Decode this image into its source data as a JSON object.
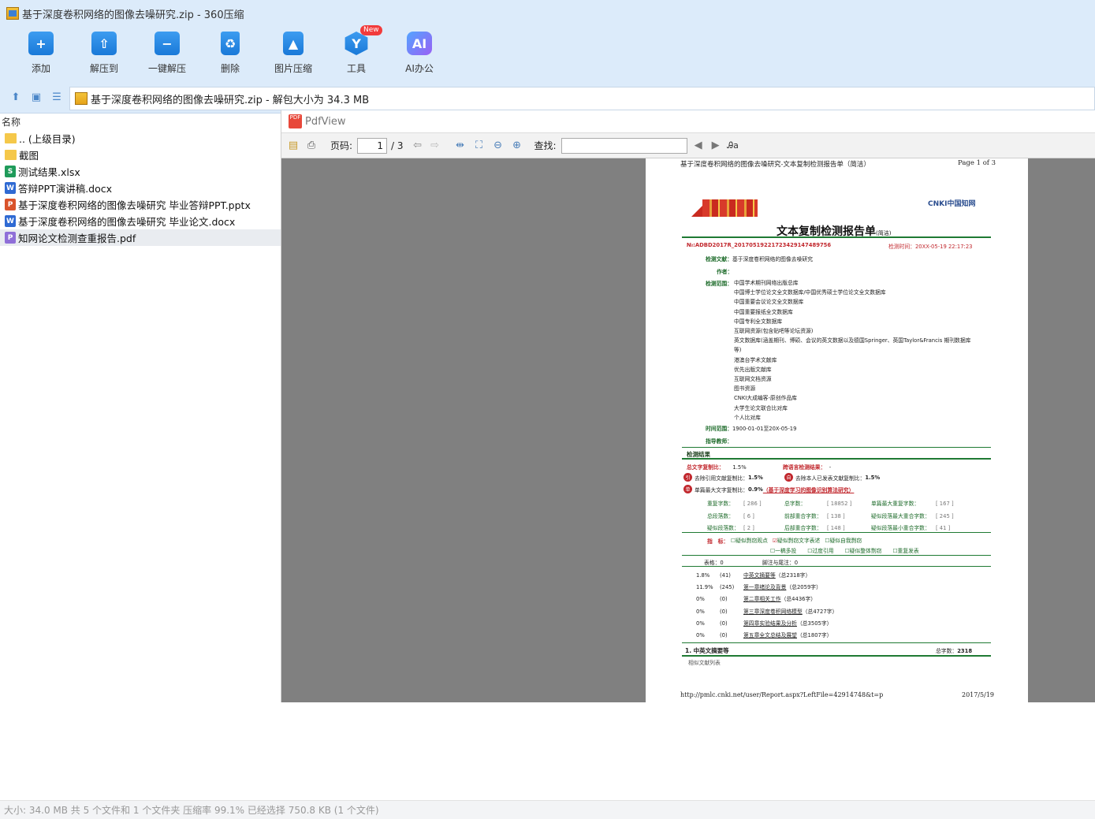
{
  "window": {
    "title": "基于深度卷积网络的图像去噪研究.zip - 360压缩"
  },
  "toolbar": {
    "buttons": [
      {
        "label": "添加",
        "icon": "add-icon"
      },
      {
        "label": "解压到",
        "icon": "extract-to-icon"
      },
      {
        "label": "一键解压",
        "icon": "one-click-extract-icon"
      },
      {
        "label": "删除",
        "icon": "trash-icon"
      },
      {
        "label": "图片压缩",
        "icon": "image-compress-icon"
      },
      {
        "label": "工具",
        "icon": "tools-icon",
        "badge": "New"
      },
      {
        "label": "AI办公",
        "icon": "ai-icon"
      }
    ]
  },
  "address": {
    "path": "基于深度卷积网络的图像去噪研究.zip - 解包大小为 34.3 MB"
  },
  "filelist": {
    "column": "名称",
    "items": [
      {
        "name": ".. (上级目录)",
        "type": "folder"
      },
      {
        "name": "截图",
        "type": "folder"
      },
      {
        "name": "测试结果.xlsx",
        "type": "xlsx"
      },
      {
        "name": "答辩PPT演讲稿.docx",
        "type": "docx"
      },
      {
        "name": "基于深度卷积网络的图像去噪研究 毕业答辩PPT.pptx",
        "type": "pptx"
      },
      {
        "name": "基于深度卷积网络的图像去噪研究 毕业论文.docx",
        "type": "docx"
      },
      {
        "name": "知网论文检测查重报告.pdf",
        "type": "pdf"
      }
    ]
  },
  "pdfview": {
    "title": "PdfView",
    "page_label": "页码:",
    "page_current": "1",
    "page_total": "/ 3",
    "find_label": "查找:",
    "header_left": "基于深度卷积网络的图像去噪研究-文本复制检测报告单（简洁）",
    "header_right": "Page 1 of 3",
    "cnki_logo": "CNKI中国知网",
    "report_title": "文本复制检测报告单",
    "report_title_sub": "(简洁)",
    "report_no": "№:ADBD2017R_20170519221723429147489756",
    "report_time": "检测时间：20XX-05-19 22:17:23",
    "doc_label": "检测文献：",
    "doc_value": "基于深度卷积网络的图像去噪研究",
    "author_label": "作者：",
    "range_label": "检测范围：",
    "ranges": [
      "中国学术期刊网络出版总库",
      "中国博士学位论文全文数据库/中国优秀硕士学位论文全文数据库",
      "中国重要会议论文全文数据库",
      "中国重要报纸全文数据库",
      "中国专利全文数据库",
      "互联网资源(包含贴吧等论坛资源)",
      "英文数据库(涵盖期刊、博硕、会议的英文数据以及德国Springer、英国Taylor&Francis 期刊数据库",
      "等)",
      "港澳台学术文献库",
      "优先出版文献库",
      "互联网文档资源",
      "图书资源",
      "CNKI大成编客-原创作品库",
      "大学生论文联合比对库",
      "个人比对库"
    ],
    "time_label": "时间范围：",
    "time_value": "1900-01-01至20X-05-19",
    "teacher_label": "指导教师：",
    "result_header": "检测结果",
    "total_label": "总文字复制比：",
    "total_value": "1.5%",
    "cross_label": "跨语言检测结果：",
    "cross_value": "-",
    "quote_label": "去除引用文献复制比：",
    "quote_value": "1.5%",
    "self_label": "去除本人已发表文献复制比：",
    "self_value": "1.5%",
    "single_label": "单篇最大文字复制比：",
    "single_value": "0.9%",
    "single_link": "（基于深度学习的图像识别算法研究）",
    "stats": [
      [
        {
          "k": "重复字数：",
          "v": "[ 286 ]"
        },
        {
          "k": "总字数：",
          "v": "[ 18852 ]"
        },
        {
          "k": "单篇最大重复字数：",
          "v": "[ 167 ]"
        }
      ],
      [
        {
          "k": "总段落数：",
          "v": "[ 6 ]"
        },
        {
          "k": "前部重合字数：",
          "v": "[ 138 ]"
        },
        {
          "k": "疑似段落最大重合字数：",
          "v": "[ 245 ]"
        }
      ],
      [
        {
          "k": "疑似段落数：",
          "v": "[ 2 ]"
        },
        {
          "k": "后部重合字数：",
          "v": "[ 148 ]"
        },
        {
          "k": "疑似段落最小重合字数：",
          "v": "[ 41 ]"
        }
      ]
    ],
    "index_label": "指　标：",
    "indices": [
      "疑似剽窃观点",
      "疑似剽窃文字表述",
      "疑似自我剽窃",
      "一稿多投",
      "过度引用",
      "疑似整体剽窃",
      "重复发表"
    ],
    "table_label": "表格：0",
    "note_label": "脚注与尾注：0",
    "sections": [
      {
        "pct": "1.8%",
        "cnt": "(41)",
        "name": "中英文摘要等",
        "total": "（总2318字）"
      },
      {
        "pct": "11.9%",
        "cnt": "(245)",
        "name": "第一章绪论及背景",
        "total": "（总2059字）"
      },
      {
        "pct": "0%",
        "cnt": "(0)",
        "name": "第二章相关工作",
        "total": "（总4436字）"
      },
      {
        "pct": "0%",
        "cnt": "(0)",
        "name": "第三章深度卷积网络模型",
        "total": "（总4727字）"
      },
      {
        "pct": "0%",
        "cnt": "(0)",
        "name": "第四章实验结果及分析",
        "total": "（总3505字）"
      },
      {
        "pct": "0%",
        "cnt": "(0)",
        "name": "第五章全文总结及展望",
        "total": "（总1807字）"
      }
    ],
    "part_title": "1. 中英文摘要等",
    "part_total_label": "总字数：",
    "part_total": "2318",
    "similar_label": "相似文献列表",
    "footer_url": "http://pmlc.cnki.net/user/Report.aspx?LeftFile=42914748&t=p",
    "footer_date": "2017/5/19"
  },
  "status": {
    "text": "大小: 34.0 MB 共 5 个文件和 1 个文件夹 压缩率 99.1% 已经选择 750.8 KB (1 个文件)"
  }
}
